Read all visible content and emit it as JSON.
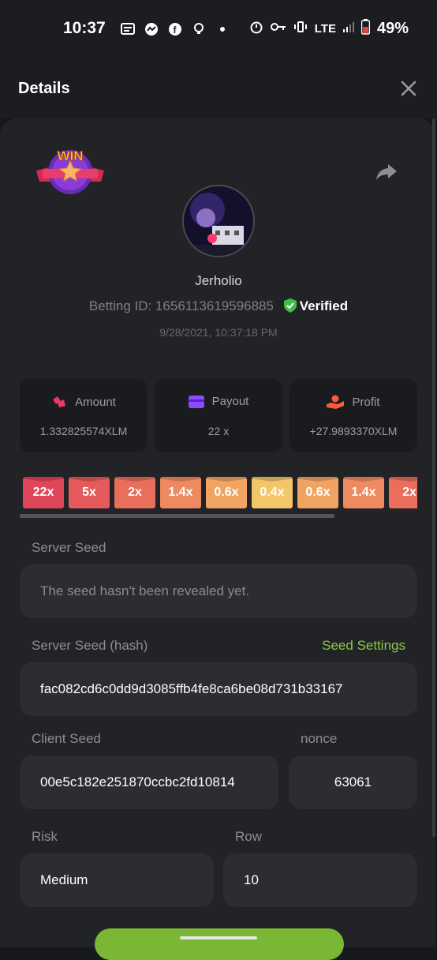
{
  "status_bar": {
    "time": "10:37",
    "network": "LTE",
    "battery": "49%"
  },
  "header": {
    "title": "Details"
  },
  "user": {
    "name": "Jerholio",
    "betting_id_label": "Betting ID: 1656113619596885",
    "verified": "Verified",
    "datetime": "9/28/2021, 10:37:18 PM",
    "win_badge_text": "WIN"
  },
  "stats": [
    {
      "label": "Amount",
      "value": "1.332825574XLM",
      "icon": "coins-icon"
    },
    {
      "label": "Payout",
      "value": "22 x",
      "icon": "card-icon"
    },
    {
      "label": "Profit",
      "value": "+27.9893370XLM",
      "icon": "hand-money-icon"
    }
  ],
  "multipliers": [
    {
      "label": "22x",
      "color": "#e0465a"
    },
    {
      "label": "5x",
      "color": "#e55a5a"
    },
    {
      "label": "2x",
      "color": "#e96e5b"
    },
    {
      "label": "1.4x",
      "color": "#ee8a60"
    },
    {
      "label": "0.6x",
      "color": "#f1a462"
    },
    {
      "label": "0.4x",
      "color": "#f3c66a"
    },
    {
      "label": "0.6x",
      "color": "#f1a462"
    },
    {
      "label": "1.4x",
      "color": "#ee8a60"
    },
    {
      "label": "2x",
      "color": "#e96e5b"
    }
  ],
  "server_seed": {
    "label": "Server Seed",
    "value": "The seed hasn't been revealed yet."
  },
  "server_seed_hash": {
    "label": "Server Seed (hash)",
    "link": "Seed Settings",
    "value": "fac082cd6c0dd9d3085ffb4fe8ca6be08d731b33167"
  },
  "client_seed": {
    "label": "Client Seed",
    "value": "00e5c182e251870ccbc2fd10814"
  },
  "nonce": {
    "label": "nonce",
    "value": "63061"
  },
  "risk": {
    "label": "Risk",
    "value": "Medium"
  },
  "row": {
    "label": "Row",
    "value": "10"
  }
}
